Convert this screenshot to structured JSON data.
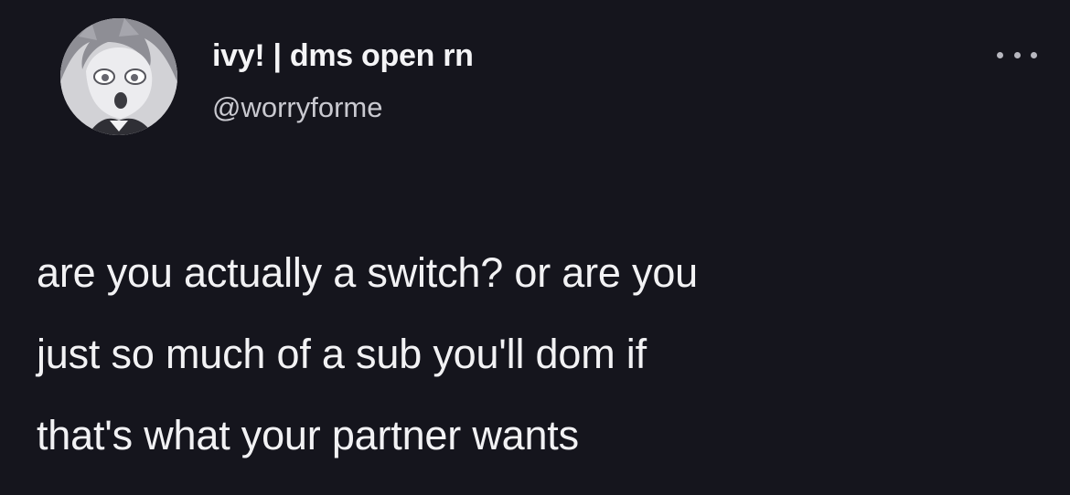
{
  "tweet": {
    "display_name": "ivy! | dms open rn",
    "handle": "@worryforme",
    "text_lines": [
      "are you actually a switch? or are you",
      "just so much of a sub you'll dom if",
      "that's what your partner wants"
    ],
    "more_icon": "more-horizontal-icon",
    "avatar_icon": "anime-avatar"
  },
  "colors": {
    "background": "#15151d",
    "text": "#f2f2f4",
    "secondary_text": "#c9c9d0"
  }
}
